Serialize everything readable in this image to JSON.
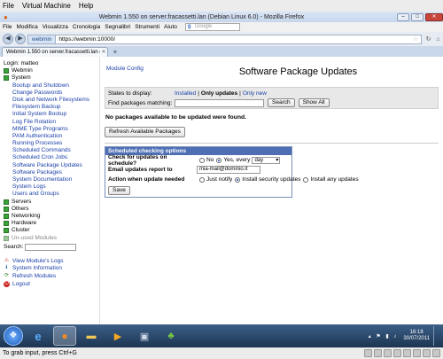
{
  "vm": {
    "menu": [
      "File",
      "Virtual Machine",
      "Help"
    ],
    "status": "To grab input, press Ctrl+G"
  },
  "firefox": {
    "title": "Webmin 1.550 on server.fracassetti.lan (Debian Linux 6.0) - Mozilla Firefox",
    "menu": [
      "File",
      "Modifica",
      "Visualizza",
      "Cronologia",
      "Segnalibri",
      "Strumenti",
      "Aiuto"
    ],
    "search_placeholder": "Google",
    "site_badge": "webmin",
    "url": "https://webmin:10000/",
    "tab_label": "Webmin 1.550 on server.fracassetti.lan (...",
    "new_tab": "+"
  },
  "sidebar": {
    "login": "Login: matteo",
    "categories_top": [
      {
        "label": "Webmin",
        "dim": false
      },
      {
        "label": "System",
        "dim": false
      }
    ],
    "system_modules": [
      "Bootup and Shutdown",
      "Change Passwords",
      "Disk and Network Filesystems",
      "Filesystem Backup",
      "Initial System Bootup",
      "Log File Rotation",
      "MIME Type Programs",
      "PAM Authentication",
      "Running Processes",
      "Scheduled Commands",
      "Scheduled Cron Jobs",
      "Software Package Updates",
      "Software Packages",
      "System Documentation",
      "System Logs",
      "Users and Groups"
    ],
    "categories_bottom": [
      {
        "label": "Servers",
        "dim": false
      },
      {
        "label": "Others",
        "dim": false
      },
      {
        "label": "Networking",
        "dim": false
      },
      {
        "label": "Hardware",
        "dim": false
      },
      {
        "label": "Cluster",
        "dim": false
      },
      {
        "label": "Un-used Modules",
        "dim": true
      }
    ],
    "search_label": "Search:",
    "links": [
      {
        "label": "View Module's Logs",
        "icon": "warning-icon"
      },
      {
        "label": "System Information",
        "icon": "info-icon"
      },
      {
        "label": "Refresh Modules",
        "icon": "refresh-icon"
      },
      {
        "label": "Logout",
        "icon": "logout-icon"
      }
    ]
  },
  "main": {
    "module_config": "Module Config",
    "title": "Software Package Updates",
    "states_label": "States to display:",
    "states": [
      "Installed",
      "Only updates",
      "Only new"
    ],
    "states_selected": "Only updates",
    "find_label": "Find packages matching:",
    "search_button": "Search",
    "show_all_button": "Show All",
    "no_packages": "No packages available to be updated were found.",
    "refresh_button": "Refresh Available Packages",
    "schedule": {
      "header": "Scheduled checking options",
      "check_label": "Check for updates on schedule?",
      "no_label": "No",
      "yes_label": "Yes, every",
      "interval": "day",
      "email_label": "Email updates report to",
      "email_value": "mia-mail@dominio.it",
      "action_label": "Action when update needed",
      "action_options": [
        "Just notify",
        "Install security updates",
        "Install any updates"
      ],
      "action_selected": 1,
      "save_button": "Save"
    }
  },
  "taskbar": {
    "time": "16:18",
    "date": "30/07/2011"
  },
  "colors": {
    "accent": "#4f6fb5",
    "link": "#1a3fa8",
    "category_green": "#3aa33a"
  }
}
